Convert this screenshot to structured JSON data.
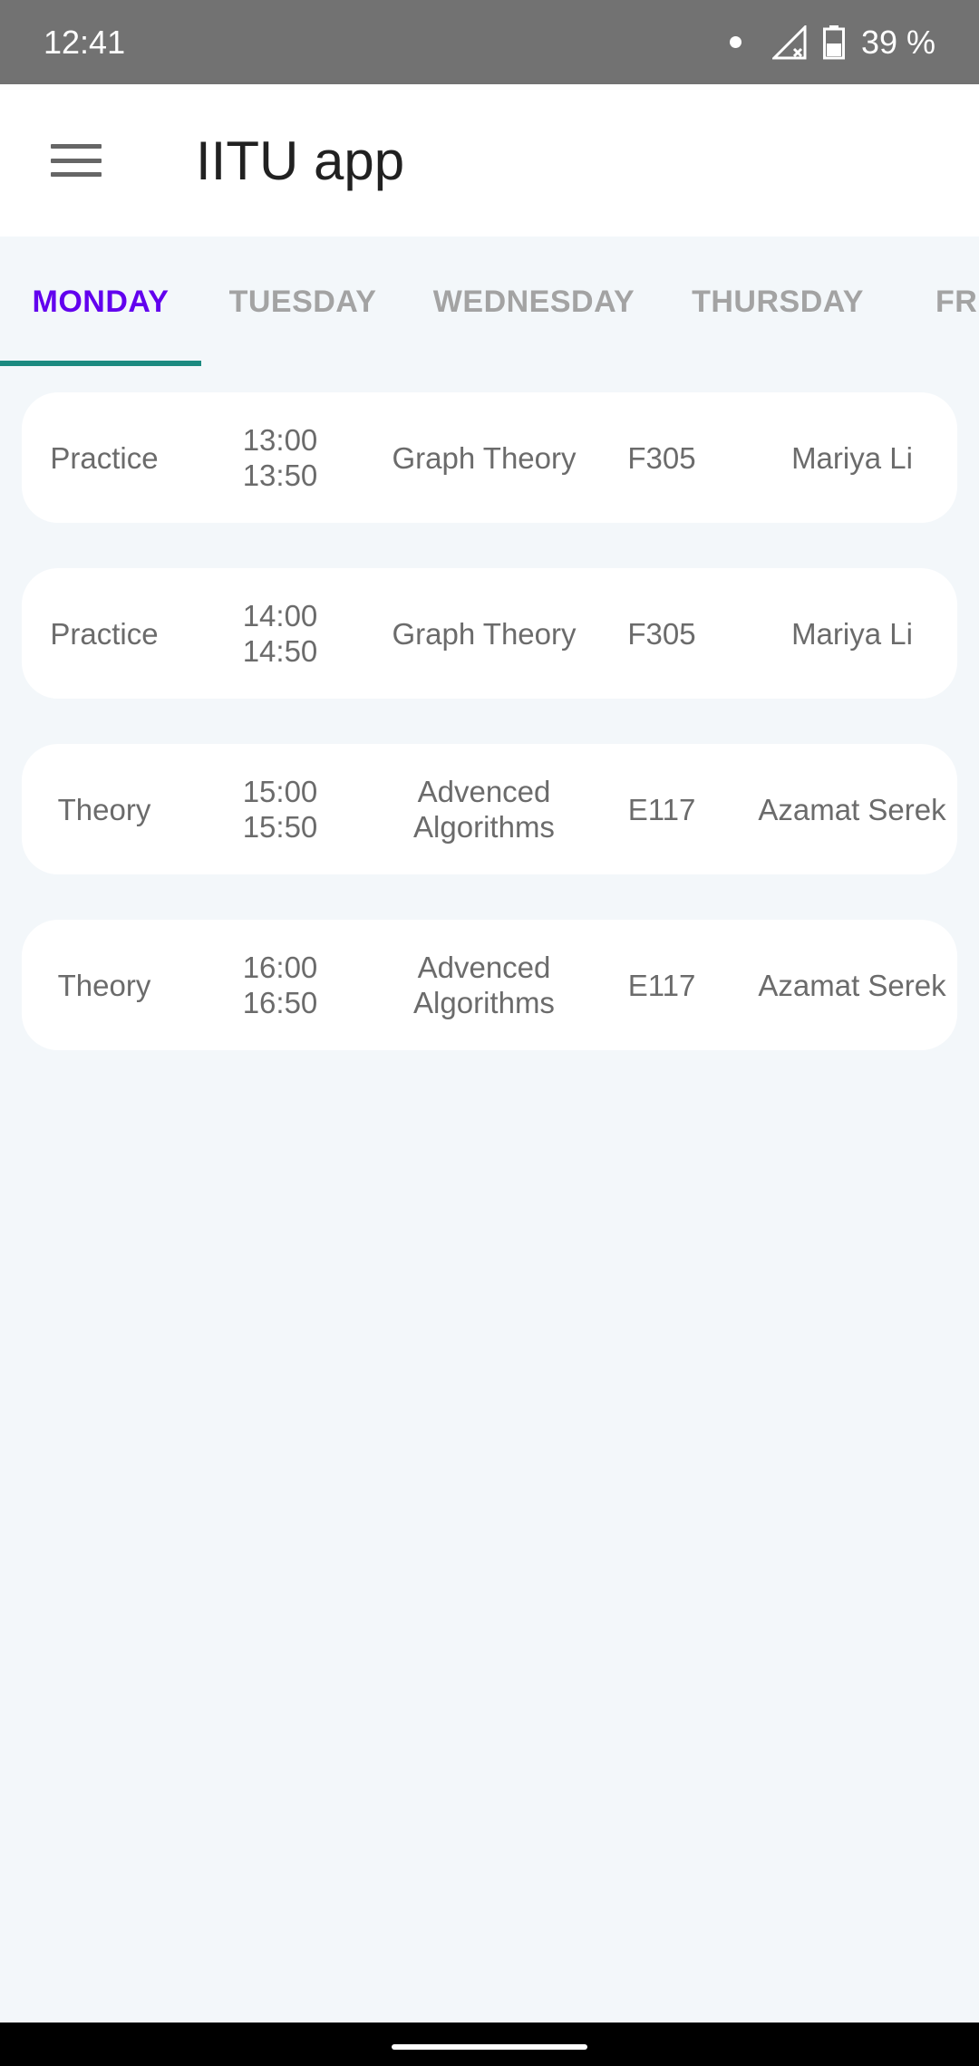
{
  "status_bar": {
    "time": "12:41",
    "battery": "39 %",
    "icons": [
      "notification-dot-icon",
      "no-signal-icon",
      "battery-icon"
    ]
  },
  "app_bar": {
    "title": "IITU app",
    "menu_icon": "hamburger-menu-icon"
  },
  "tabs": [
    {
      "label": "MONDAY",
      "active": true
    },
    {
      "label": "TUESDAY",
      "active": false
    },
    {
      "label": "WEDNESDAY",
      "active": false
    },
    {
      "label": "THURSDAY",
      "active": false
    },
    {
      "label": "FRI",
      "active": false
    }
  ],
  "colors": {
    "accent": "#6200ee",
    "indicator": "#1b8a80",
    "status_bar": "#727272",
    "background": "#f3f7fa"
  },
  "schedule": [
    {
      "type": "Practice",
      "start": "13:00",
      "end": "13:50",
      "subject_line1": "Graph Theory",
      "subject_line2": "",
      "room": "F305",
      "teacher": "Mariya Li"
    },
    {
      "type": "Practice",
      "start": "14:00",
      "end": "14:50",
      "subject_line1": "Graph Theory",
      "subject_line2": "",
      "room": "F305",
      "teacher": "Mariya Li"
    },
    {
      "type": "Theory",
      "start": "15:00",
      "end": "15:50",
      "subject_line1": "Advenced",
      "subject_line2": "Algorithms",
      "room": "E117",
      "teacher": "Azamat Serek"
    },
    {
      "type": "Theory",
      "start": "16:00",
      "end": "16:50",
      "subject_line1": "Advenced",
      "subject_line2": "Algorithms",
      "room": "E117",
      "teacher": "Azamat Serek"
    }
  ]
}
